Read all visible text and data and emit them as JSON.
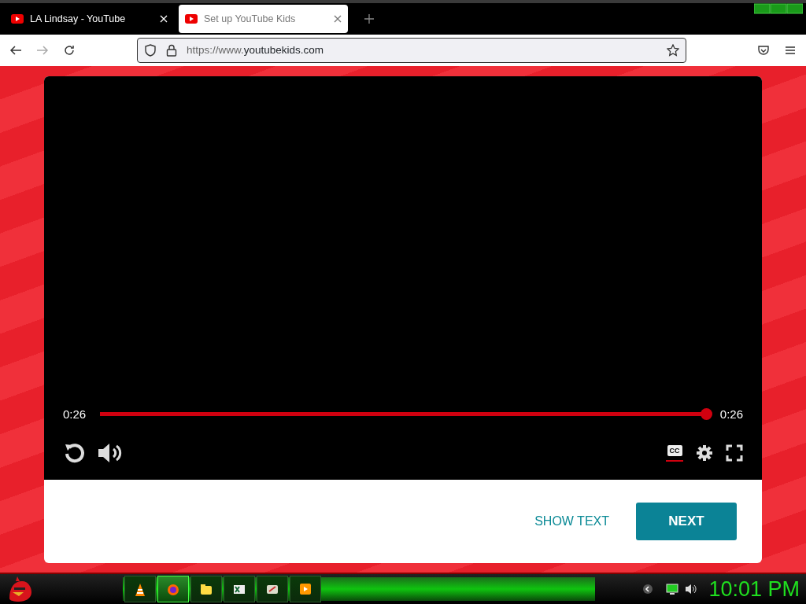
{
  "browser": {
    "tabs": [
      {
        "title": "LA Lindsay - YouTube",
        "selected": false
      },
      {
        "title": "Set up YouTube Kids",
        "selected": true
      }
    ],
    "url": {
      "prefix": "https://www.",
      "domain": "youtubekids.com"
    }
  },
  "player": {
    "elapsed": "0:26",
    "duration": "0:26",
    "progress": {
      "level": 1.0
    },
    "captions": {
      "label": "CC",
      "on": true
    }
  },
  "actions": {
    "secondary": "SHOW TEXT",
    "primary": "NEXT"
  },
  "taskbar": {
    "apps": [
      {
        "kind": "cone",
        "selected": false
      },
      {
        "kind": "browser",
        "selected": true
      },
      {
        "kind": "folder",
        "selected": false
      },
      {
        "kind": "sheet",
        "selected": false
      },
      {
        "kind": "tools",
        "selected": false
      },
      {
        "kind": "player",
        "selected": false
      }
    ],
    "clock": "10:01 PM"
  }
}
